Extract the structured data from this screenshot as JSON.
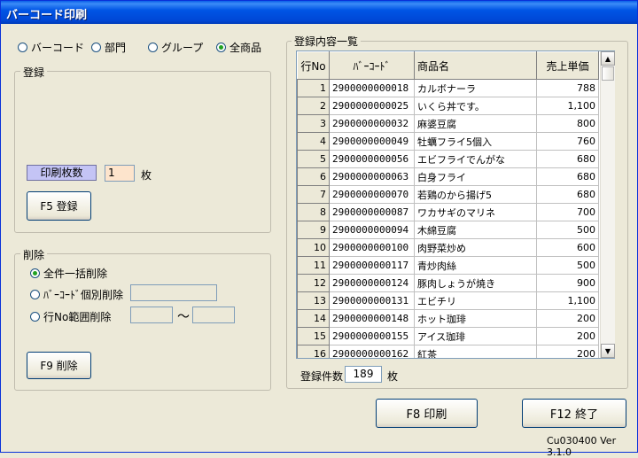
{
  "window": {
    "title": "バーコード印刷"
  },
  "filter": {
    "options": [
      {
        "label": "バーコード",
        "checked": false
      },
      {
        "label": "部門",
        "checked": false
      },
      {
        "label": "グループ",
        "checked": false
      },
      {
        "label": "全商品",
        "checked": true
      }
    ]
  },
  "register": {
    "legend": "登録",
    "copies_label": "印刷枚数",
    "copies_value": "1",
    "unit": "枚",
    "button": "F5 登録"
  },
  "delete": {
    "legend": "削除",
    "options": [
      {
        "label": "全件一括削除",
        "checked": true
      },
      {
        "label": "ﾊﾞｰｺｰﾄﾞ個別削除",
        "checked": false
      },
      {
        "label": "行No範囲削除",
        "checked": false
      }
    ],
    "range_sep": "～",
    "button": "F9 削除"
  },
  "list": {
    "legend": "登録内容一覧",
    "columns": [
      "行No",
      "ﾊﾞｰｺｰﾄﾞ",
      "商品名",
      "売上単価"
    ],
    "rows": [
      [
        "1",
        "2900000000018",
        "カルボナーラ",
        "788"
      ],
      [
        "2",
        "2900000000025",
        "いくら丼です。",
        "1,100"
      ],
      [
        "3",
        "2900000000032",
        "麻婆豆腐",
        "800"
      ],
      [
        "4",
        "2900000000049",
        "牡蠣フライ5個入",
        "760"
      ],
      [
        "5",
        "2900000000056",
        "エビフライでんがな",
        "680"
      ],
      [
        "6",
        "2900000000063",
        "白身フライ",
        "680"
      ],
      [
        "7",
        "2900000000070",
        "若鶏のから揚げ5",
        "680"
      ],
      [
        "8",
        "2900000000087",
        "ワカサギのマリネ",
        "700"
      ],
      [
        "9",
        "2900000000094",
        "木綿豆腐",
        "500"
      ],
      [
        "10",
        "2900000000100",
        "肉野菜炒め",
        "600"
      ],
      [
        "11",
        "2900000000117",
        "青炒肉絲",
        "500"
      ],
      [
        "12",
        "2900000000124",
        "豚肉しょうが焼き",
        "900"
      ],
      [
        "13",
        "2900000000131",
        "エビチリ",
        "1,100"
      ],
      [
        "14",
        "2900000000148",
        "ホット珈琲",
        "200"
      ],
      [
        "15",
        "2900000000155",
        "アイス珈琲",
        "200"
      ],
      [
        "16",
        "2900000000162",
        "紅茶",
        "200"
      ]
    ],
    "count_label": "登録件数",
    "count_value": "189",
    "count_unit": "枚"
  },
  "footer": {
    "print_button": "F8 印刷",
    "exit_button": "F12 終了",
    "version": "Cu030400 Ver 3.1.0"
  },
  "icons": {
    "scroll_up": "scroll-up-arrow-icon",
    "scroll_down": "scroll-down-arrow-icon"
  }
}
